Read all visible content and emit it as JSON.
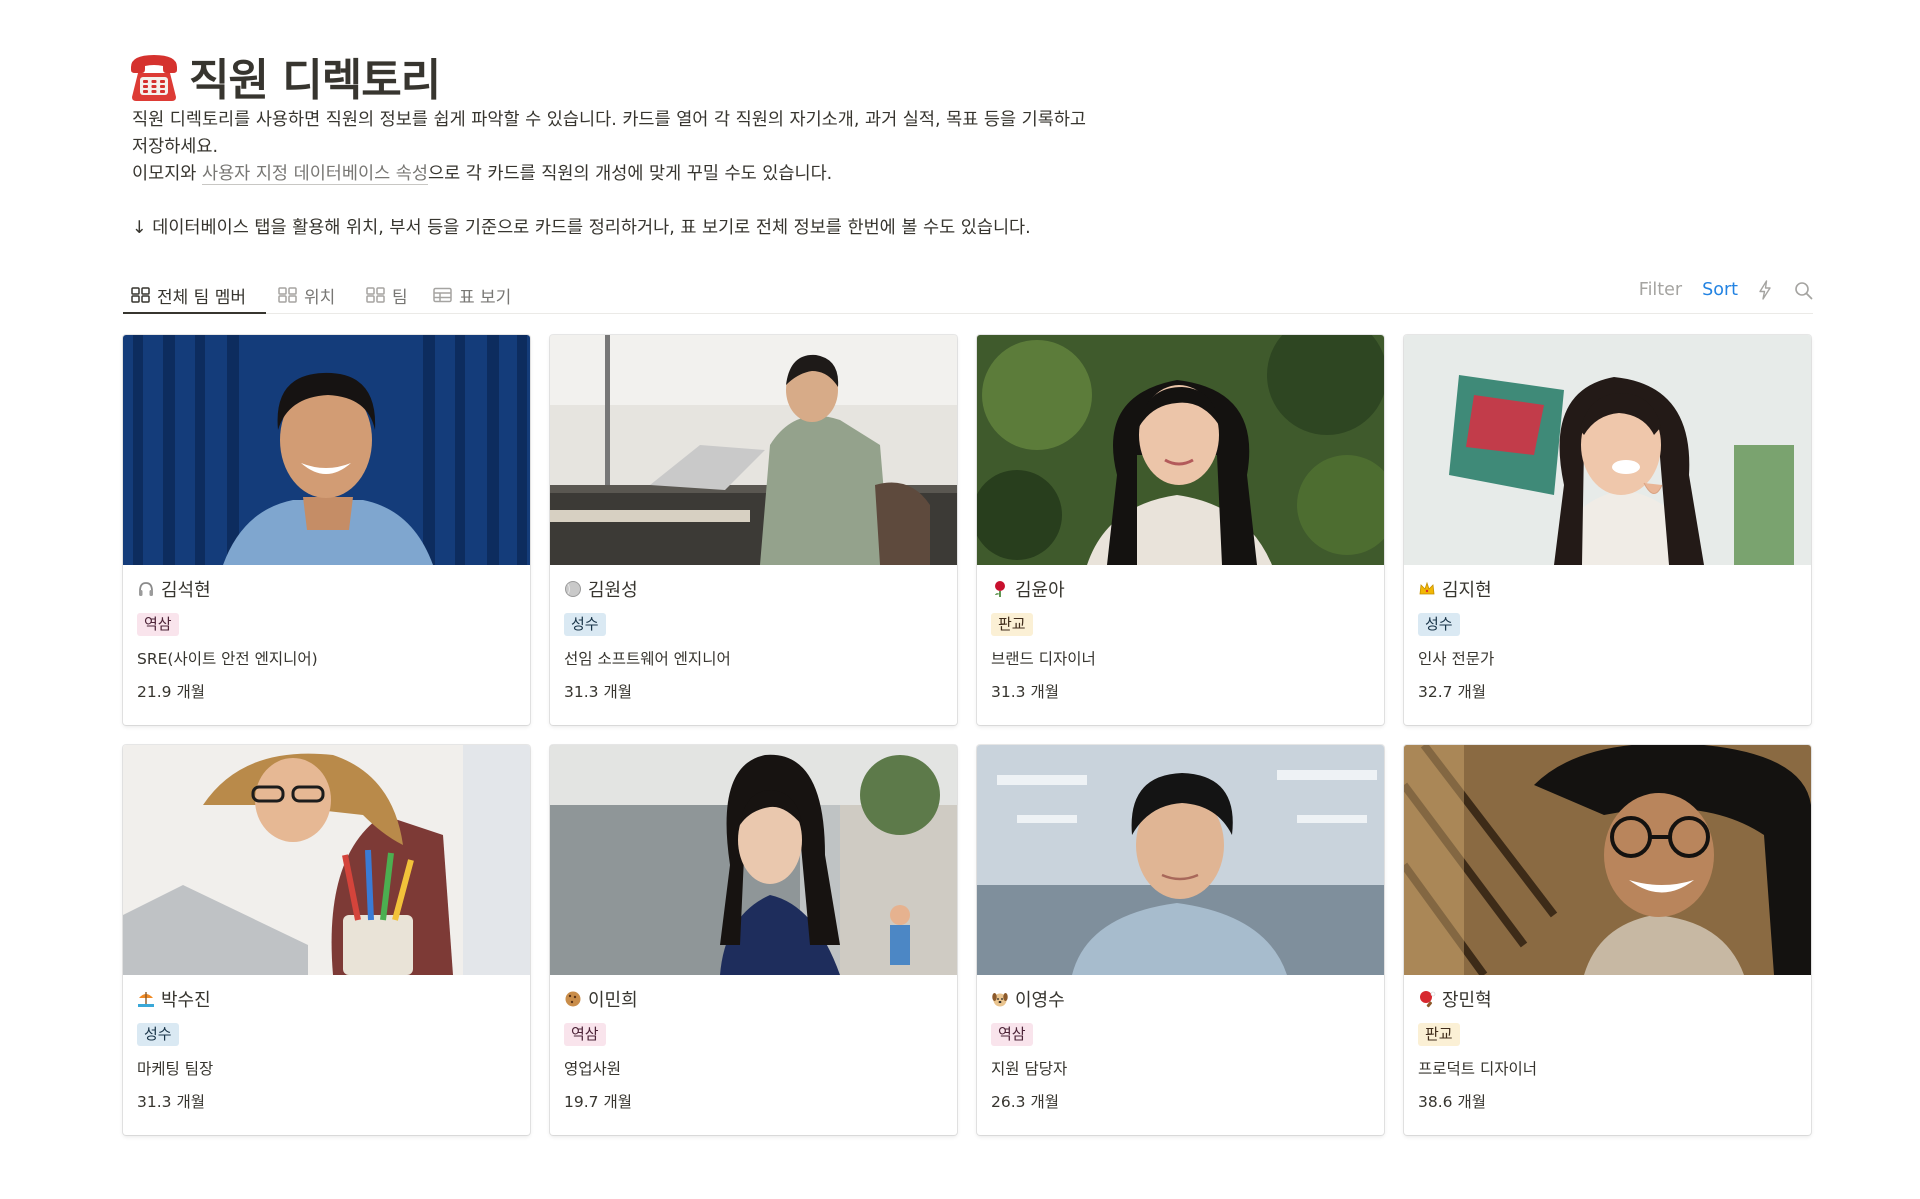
{
  "page": {
    "title": "직원 디렉토리",
    "title_icon": "telephone-icon",
    "description_lines": [
      "직원 디렉토리를 사용하면 직원의 정보를 쉽게 파악할 수 있습니다. 카드를 열어 각 직원의 자기소개, 과거 실적, 목표 등을 기록하고",
      "저장하세요."
    ],
    "line3_prefix": "이모지와 ",
    "line3_link": "사용자 지정 데이터베이스 속성",
    "line3_suffix": "으로 각 카드를 직원의 개성에 맞게 꾸밀 수도 있습니다.",
    "line4": "↓ 데이터베이스 탭을 활용해 위치, 부서 등을 기준으로 카드를 정리하거나, 표 보기로 전체 정보를 한번에 볼 수도 있습니다."
  },
  "tabs": [
    {
      "label": "전체 팀 멤버",
      "icon": "gallery-icon",
      "active": true
    },
    {
      "label": "위치",
      "icon": "gallery-icon",
      "active": false
    },
    {
      "label": "팀",
      "icon": "gallery-icon",
      "active": false
    },
    {
      "label": "표 보기",
      "icon": "table-icon",
      "active": false
    }
  ],
  "toolbar": {
    "filter_label": "Filter",
    "sort_label": "Sort",
    "automation_icon": "lightning-icon",
    "search_icon": "search-icon"
  },
  "colors": {
    "text": "#37352f",
    "muted": "#787774",
    "sort_blue": "#2383e2",
    "badge_pink_bg": "#f9e4ec",
    "badge_pink_text": "#4c2337",
    "badge_blue_bg": "#dae9f3",
    "badge_blue_text": "#183347",
    "badge_yellow_bg": "#fbf0d5",
    "badge_yellow_text": "#402c1b"
  },
  "cards": [
    {
      "emoji": "headphones-icon",
      "name": "김석현",
      "location": "역삼",
      "badge_color": "pink",
      "role": "SRE(사이트 안전 엔지니어)",
      "tenure": "21.9 개월"
    },
    {
      "emoji": "baseball-icon",
      "name": "김원성",
      "location": "성수",
      "badge_color": "blue",
      "role": "선임 소프트웨어 엔지니어",
      "tenure": "31.3 개월"
    },
    {
      "emoji": "rose-icon",
      "name": "김윤아",
      "location": "판교",
      "badge_color": "yellow",
      "role": "브랜드 디자이너",
      "tenure": "31.3 개월"
    },
    {
      "emoji": "crown-icon",
      "name": "김지현",
      "location": "성수",
      "badge_color": "blue",
      "role": "인사 전문가",
      "tenure": "32.7 개월"
    },
    {
      "emoji": "beach-umbrella-icon",
      "name": "박수진",
      "location": "성수",
      "badge_color": "blue",
      "role": "마케팅 팀장",
      "tenure": "31.3 개월"
    },
    {
      "emoji": "cookie-icon",
      "name": "이민희",
      "location": "역삼",
      "badge_color": "pink",
      "role": "영업사원",
      "tenure": "19.7 개월"
    },
    {
      "emoji": "dog-face-icon",
      "name": "이영수",
      "location": "역삼",
      "badge_color": "pink",
      "role": "지원 담당자",
      "tenure": "26.3 개월"
    },
    {
      "emoji": "ping-pong-icon",
      "name": "장민혁",
      "location": "판교",
      "badge_color": "yellow",
      "role": "프로덕트 디자이너",
      "tenure": "38.6 개월"
    }
  ]
}
